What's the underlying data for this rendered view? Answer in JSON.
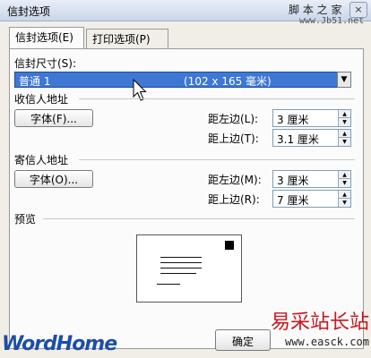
{
  "window": {
    "title": "信封选项",
    "close_label": "×"
  },
  "watermark_top": {
    "text": "脚 本 之 家",
    "url": "www.Jb51.net"
  },
  "tabs": [
    {
      "label": "信封选项(E)",
      "active": true
    },
    {
      "label": "打印选项(P)",
      "active": false
    }
  ],
  "envelope_size": {
    "label": "信封尺寸(S):",
    "selected_value": "普通 1",
    "selected_dimensions": "(102 x 165 毫米)"
  },
  "recipient": {
    "section_label": "收信人地址",
    "font_button": "字体(F)...",
    "from_left_label": "距左边(L):",
    "from_left_value": "3 厘米",
    "from_top_label": "距上边(T):",
    "from_top_value": "3.1 厘米"
  },
  "sender": {
    "section_label": "寄信人地址",
    "font_button": "字体(O)...",
    "from_left_label": "距左边(M):",
    "from_left_value": "3 厘米",
    "from_top_label": "距上边(R):",
    "from_top_value": "7 厘米"
  },
  "preview": {
    "label": "预览"
  },
  "footer": {
    "ok_button": "确定"
  },
  "watermark_bottom": {
    "brand": "WordHome",
    "site_name": "易采站长站",
    "site_url": "www.easck.com"
  },
  "colors": {
    "selection": "#3e78d4",
    "brand_blue": "#1d4ea6",
    "watermark_red": "#c8171f"
  }
}
